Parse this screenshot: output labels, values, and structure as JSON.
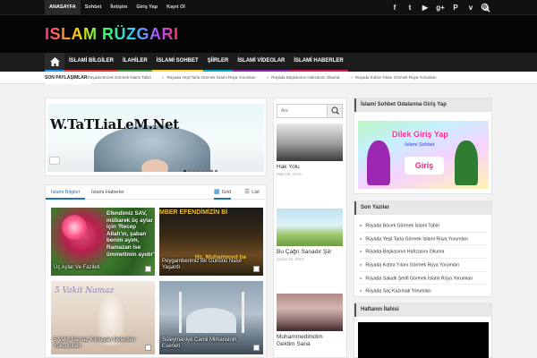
{
  "topbar": {
    "nav": [
      "ANASAYFA",
      "Sohbet",
      "İletişim",
      "Giriş Yap",
      "Kayıt Ol"
    ],
    "social_icons": [
      "facebook-icon",
      "twitter-icon",
      "youtube-icon",
      "google-plus-icon",
      "pinterest-icon",
      "vimeo-icon",
      "instagram-icon"
    ],
    "social_glyphs": [
      "f",
      "t",
      "▶",
      "g+",
      "P",
      "v",
      "◎"
    ]
  },
  "header": {
    "logo": "ISLAM RÜZGARI"
  },
  "mainnav": {
    "items": [
      "İSLAMİ BİLGİLER",
      "İLAHİLER",
      "İSLAMİ SOHBET",
      "ŞİİRLER",
      "İSLAMİ VİDEOLAR",
      "İSLAMİ HABERLER"
    ]
  },
  "ticker": {
    "label": "SON PAYLAŞIMLAR",
    "items": [
      "Rüyada Böcek Görmek İslami Tabiri",
      "Rüyada Yeşil Tarla Görmek İslami Rüya Yorumları",
      "Rüyada Başkasının Hafızasını Okuma",
      "Rüyada Kobra Yılanı Görmek Rüya Yorumları"
    ]
  },
  "slider": {
    "text": "W.TaTLiaLeM.Net",
    "dots": 8
  },
  "tabs": {
    "tab1": "İslami Bilgiler",
    "tab2": "İslami Haberler",
    "grid": "Grid",
    "list": "List"
  },
  "posts": [
    {
      "caption": "Üç Aylar Ve Fazileti",
      "overlay": "Efendimiz SAV, mübarek üç aylar için 'Recep Allah'ın, şaban benim ayım, Ramazan ise ümmetimin ayıdır'"
    },
    {
      "caption": "Peygamberimiz Bir Gününü Nasıl Yaşardı",
      "overlay": "MBER EFENDİMİZİN Bİ",
      "overlay2": "Hz. Muhammed he"
    },
    {
      "caption": "5 Vakit Namaz Kılmayan Nelerden Yoksunkalır",
      "overlay": "5 Vakit Namaz"
    },
    {
      "caption": "Süleymaniye Camii Mimarisinin Eserleri"
    }
  ],
  "middle": {
    "search_placeholder": "Ara",
    "items": [
      {
        "title": "Hak Yolu",
        "date": "Mart 09, 2015"
      },
      {
        "title": "Bu Çağrı Sanadır Şiir",
        "date": "Şubat 18, 2015"
      },
      {
        "title": "Muhammedimdim Geldim Sana",
        "date": ""
      }
    ]
  },
  "sidebar": {
    "box1_title": "İslami Sohbet Odalarına Giriş Yap",
    "banner_text": "Dilek Giriş Yap",
    "banner_sub": "İslami Sohbet",
    "banner_sign": "Giriş",
    "box2_title": "Son Yazılar",
    "recent": [
      "Rüyada Böcek Görmek İslami Tabiri",
      "Rüyada Yeşil Tarla Görmek İslami Rüya Yorumları",
      "Rüyada Başkasının Hafızasını Okuma",
      "Rüyada Kobra Yılanı Görmek Rüya Yorumları",
      "Rüyada Sakallı Şerifi Görmek İslami Rüya Yorumları",
      "Rüyada Saç Kazımak Yorumları"
    ],
    "box3_title": "Haftanın İlahisi"
  },
  "colors": {
    "accent": "#1e73be",
    "topbar_bg": "#111111",
    "header_bg": "#050505"
  }
}
